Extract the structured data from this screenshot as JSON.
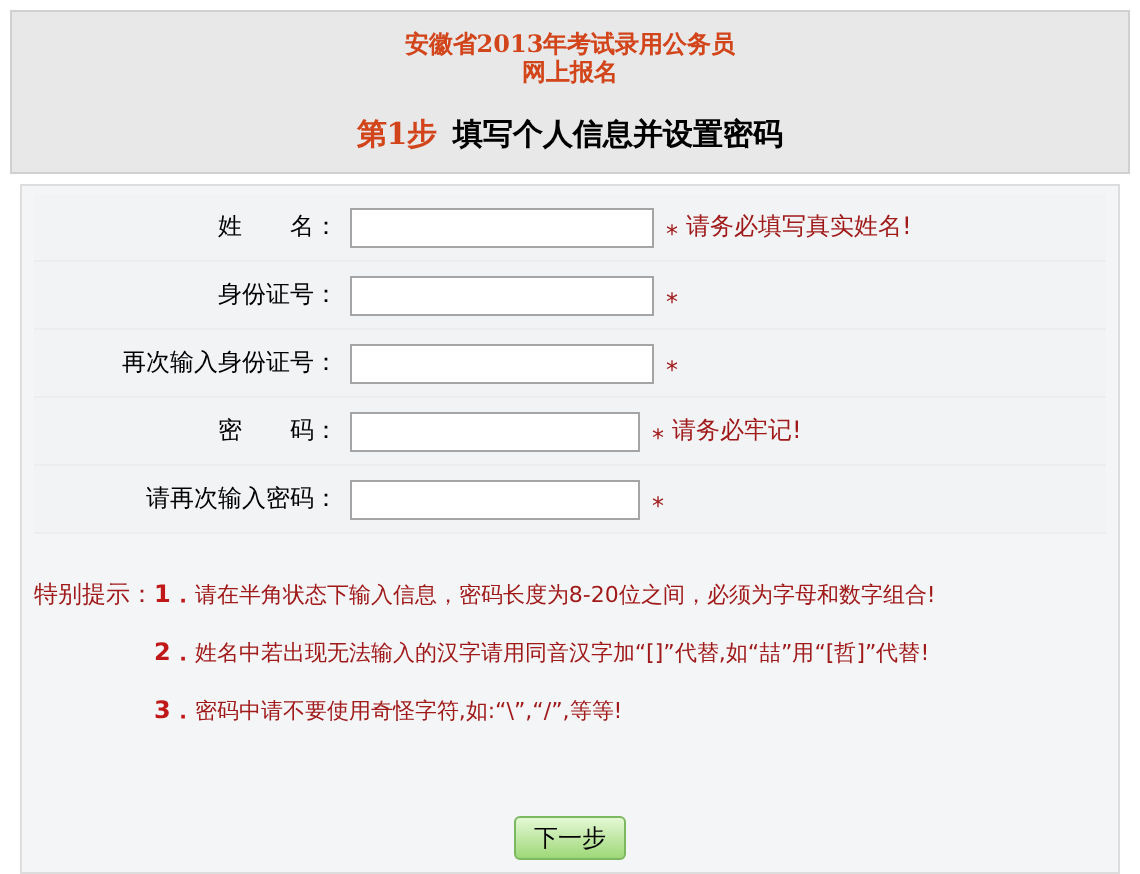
{
  "header": {
    "title_lines": [
      "安徽省2013年考试录用公务员",
      "网上报名"
    ],
    "step_label": "第1步",
    "step_title": "填写个人信息并设置密码"
  },
  "fields": [
    {
      "label": "姓　　名：",
      "kind": "text",
      "required": "*",
      "note": "请务必填写真实姓名!"
    },
    {
      "label": "身份证号：",
      "kind": "text",
      "required": "*"
    },
    {
      "label": "再次输入身份证号：",
      "kind": "text",
      "required": "*"
    },
    {
      "label": "密　　码：",
      "kind": "password",
      "required": "*",
      "note": "请务必牢记!"
    },
    {
      "label": "请再次输入密码：",
      "kind": "password",
      "required": "*"
    }
  ],
  "notes": {
    "heading": "特别提示：",
    "items": [
      {
        "number": "1．",
        "text": "请在半角状态下输入信息，密码长度为8-20位之间，必须为字母和数字组合!"
      },
      {
        "number": "2．",
        "text": "姓名中若出现无法输入的汉字请用同音汉字加“[]”代替,如“喆”用“[哲]”代替!"
      },
      {
        "number": "3．",
        "text": "密码中请不要使用奇怪字符,如:“\\”,“/”,等等!"
      }
    ]
  },
  "next_button": "下一步"
}
